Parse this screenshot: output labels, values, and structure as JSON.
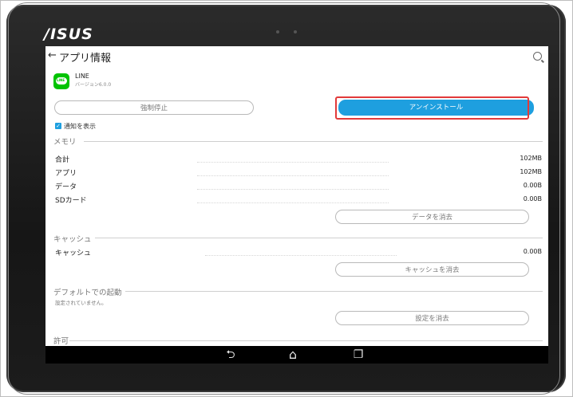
{
  "device": {
    "brand": "/ISUS"
  },
  "appbar": {
    "back_glyph": "←",
    "title": "アプリ情報"
  },
  "app": {
    "name": "LINE",
    "version": "バージョン6.0.0"
  },
  "buttons": {
    "force_stop": "強制停止",
    "uninstall": "アンインストール",
    "clear_data": "データを消去",
    "clear_cache": "キャッシュを消去",
    "clear_defaults": "設定を消去"
  },
  "notifications": {
    "label": "通知を表示",
    "checked": true
  },
  "memory": {
    "header": "メモリ",
    "rows": [
      {
        "label": "合計",
        "value": "102MB"
      },
      {
        "label": "アプリ",
        "value": "102MB"
      },
      {
        "label": "データ",
        "value": "0.00B"
      },
      {
        "label": "SDカード",
        "value": "0.00B"
      }
    ]
  },
  "cache": {
    "header": "キャッシュ",
    "label": "キャッシュ",
    "value": "0.00B"
  },
  "defaults": {
    "header": "デフォルトでの起動",
    "note": "設定されていません。"
  },
  "permissions": {
    "header": "許可"
  },
  "navbar": {
    "back": "⮌",
    "home": "⌂",
    "recents": "❐"
  },
  "colors": {
    "accent": "#1e9fdf",
    "highlight": "#e23a3a",
    "bezel": "#1c1c1c"
  }
}
